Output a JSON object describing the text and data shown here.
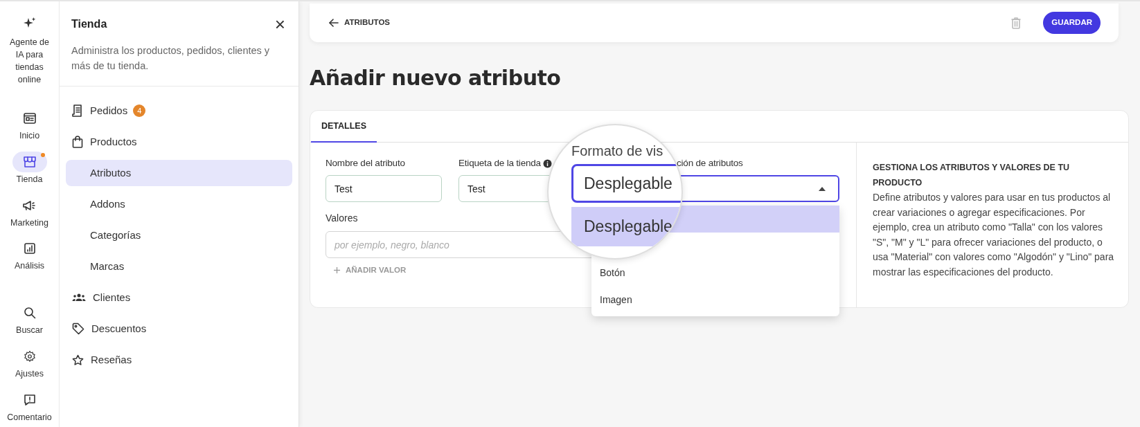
{
  "rail": {
    "agent": {
      "label": "Agente de IA para tiendas online"
    },
    "items": [
      {
        "label": "Inicio",
        "selected": false,
        "notification": false
      },
      {
        "label": "Tienda",
        "selected": true,
        "notification": true
      },
      {
        "label": "Marketing",
        "selected": false,
        "notification": false
      },
      {
        "label": "Análisis",
        "selected": false,
        "notification": false
      },
      {
        "label": "Buscar",
        "selected": false,
        "notification": false
      },
      {
        "label": "Ajustes",
        "selected": false,
        "notification": false
      },
      {
        "label": "Comentario",
        "selected": false,
        "notification": false
      }
    ]
  },
  "sidebar": {
    "title": "Tienda",
    "close": "×",
    "description": "Administra los productos, pedidos, clientes y más de tu tienda.",
    "items": [
      {
        "label": "Pedidos",
        "selected": false,
        "badge": "4"
      },
      {
        "label": "Productos",
        "selected": false,
        "children": [
          {
            "label": "Atributos",
            "selected": true
          },
          {
            "label": "Addons",
            "selected": false
          },
          {
            "label": "Categorías",
            "selected": false
          },
          {
            "label": "Marcas",
            "selected": false
          }
        ]
      },
      {
        "label": "Clientes",
        "selected": false
      },
      {
        "label": "Descuentos",
        "selected": false
      },
      {
        "label": "Reseñas",
        "selected": false
      }
    ]
  },
  "top_bar": {
    "back": "ATRIBUTOS",
    "save": "GUARDAR"
  },
  "title": "Añadir nuevo atributo",
  "tabs": [
    {
      "label": "DETALLES",
      "selected": true
    }
  ],
  "fields": [
    {
      "kind": "text",
      "label": "Nombre del atributo",
      "value": "Test"
    },
    {
      "kind": "text",
      "label": "Etiqueta de la tienda",
      "info": true,
      "value": "Test"
    },
    {
      "kind": "select",
      "label": "ción de atributos",
      "expanded": true,
      "options": [
        {
          "label": "Botón",
          "selected": false
        },
        {
          "label": "Imagen",
          "selected": false
        }
      ]
    }
  ],
  "values": {
    "label": "Valores",
    "placeholder": "por ejemplo, negro, blanco",
    "add": "AÑADIR VALOR"
  },
  "magnifier": {
    "label": "Formato de vis",
    "value": "Desplegable",
    "option": {
      "label": "Desplegable",
      "selected": true
    }
  },
  "help": {
    "title": "GESTIONA LOS ATRIBUTOS Y VALORES DE TU PRODUCTO",
    "body": "Define atributos y valores para usar en tus productos al crear variaciones o agregar especificaciones. Por ejemplo, crea un atributo como \"Talla\" con los valores \"S\", \"M\" y \"L\" para ofrecer variaciones del producto, o usa \"Material\" con valores como \"Algodón\" y \"Lino\" para mostrar las especificaciones del producto."
  }
}
